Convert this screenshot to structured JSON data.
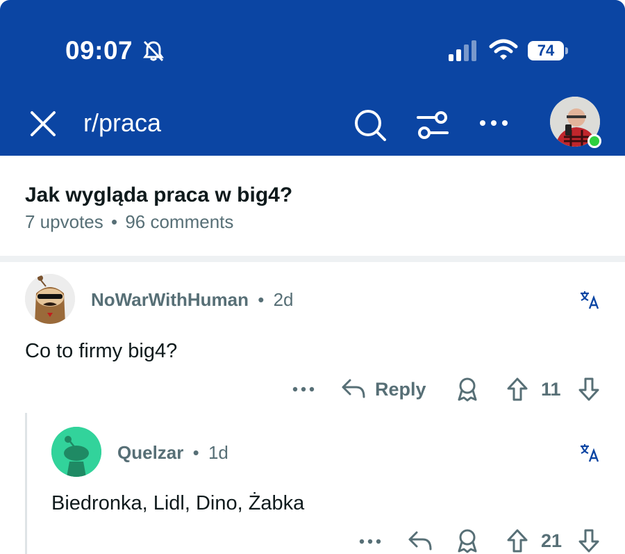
{
  "status_bar": {
    "time": "09:07",
    "battery": "74"
  },
  "top_bar": {
    "subreddit": "r/praca"
  },
  "post": {
    "title": "Jak wygląda praca w big4?",
    "upvotes": "7 upvotes",
    "separator": "•",
    "comments": "96 comments"
  },
  "comments": [
    {
      "author": "NoWarWithHuman",
      "separator": "•",
      "age": "2d",
      "body": "Co to firmy big4?",
      "reply_label": "Reply",
      "votes": "11"
    },
    {
      "author": "Quelzar",
      "separator": "•",
      "age": "1d",
      "body": "Biedronka, Lidl, Dino, Żabka",
      "votes": "21"
    }
  ],
  "colors": {
    "header_bg": "#0b45a3",
    "online": "#2ed03f",
    "meta_text": "#576f76",
    "avatar2_bg": "#32d39b"
  }
}
